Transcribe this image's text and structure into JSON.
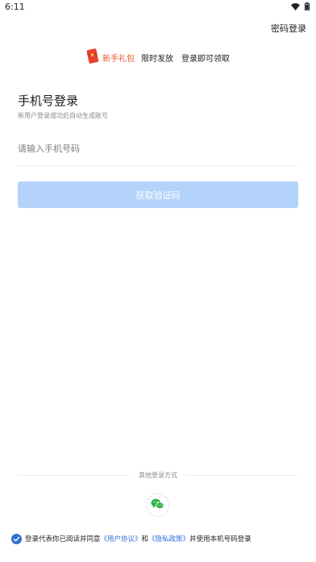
{
  "status_bar": {
    "time": "6:11",
    "icons": [
      "wifi-icon",
      "battery-icon"
    ]
  },
  "header": {
    "password_login_label": "密码登录"
  },
  "promo": {
    "icon": "red-envelope-icon",
    "gift_label": "新手礼包",
    "text1": "限时发放",
    "text2": "登录即可领取",
    "gift_color": "#e8542f"
  },
  "login": {
    "title": "手机号登录",
    "subtitle": "新用户登录成功后自动生成账号",
    "phone_placeholder": "请输入手机号码",
    "phone_value": "",
    "get_code_label": "获取验证码"
  },
  "other_login": {
    "label": "其他登录方式",
    "options": [
      {
        "name": "wechat",
        "icon": "wechat-icon",
        "color": "#2fb342"
      }
    ]
  },
  "agreement": {
    "checked": true,
    "prefix": "登录代表你已阅读并同意",
    "user_agreement": "《用户协议》",
    "and": "和",
    "privacy_policy": "《隐私政策》",
    "suffix": "并使用本机号码登录"
  },
  "colors": {
    "accent": "#2f6fd6",
    "button_disabled": "#b3d3fb"
  }
}
